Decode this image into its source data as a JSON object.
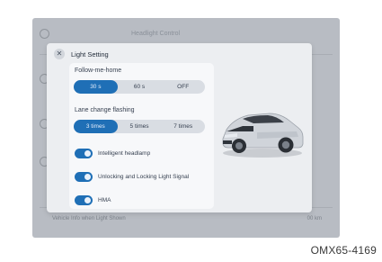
{
  "background": {
    "title": "Headlight Control",
    "footer_left": "Vehicle Info  when Light Shown",
    "footer_right": "00 km"
  },
  "dialog": {
    "title": "Light Setting",
    "close_icon": "close-icon"
  },
  "follow_me_home": {
    "label": "Follow-me-home",
    "options": [
      "30 s",
      "60 s",
      "OFF"
    ],
    "selected": "30 s"
  },
  "lane_change_flashing": {
    "label": "Lane change flashing",
    "options": [
      "3 times",
      "5 times",
      "7 times"
    ],
    "selected": "3 times"
  },
  "toggles": [
    {
      "label": "Intelligent headlamp",
      "on": true
    },
    {
      "label": "Unlocking and Locking Light Signal",
      "on": true
    },
    {
      "label": "HMA",
      "on": true
    }
  ],
  "colors": {
    "accent": "#1f6fb6",
    "dialog_bg": "#eceef1",
    "screen_bg": "#b8bcc3"
  },
  "figure_code": "OMX65-4169"
}
